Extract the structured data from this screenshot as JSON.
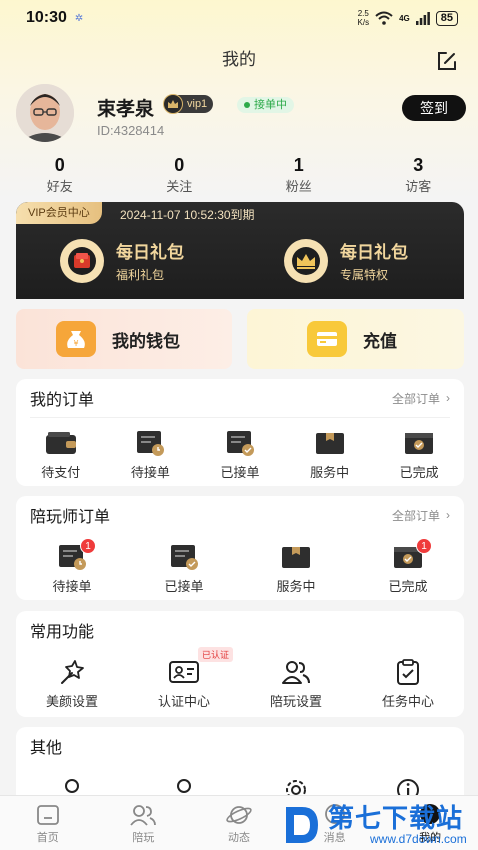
{
  "status_bar": {
    "time": "10:30",
    "net_speed_top": "2.5",
    "net_speed_bottom": "K/s",
    "signal": "4G",
    "battery": "85"
  },
  "header": {
    "title": "我的"
  },
  "profile": {
    "name": "束孝泉",
    "vip_level": "vip1",
    "status": "接单中",
    "user_id": "ID:4328414",
    "checkin_label": "签到"
  },
  "stats": [
    {
      "value": "0",
      "label": "好友"
    },
    {
      "value": "0",
      "label": "关注"
    },
    {
      "value": "1",
      "label": "粉丝"
    },
    {
      "value": "3",
      "label": "访客"
    }
  ],
  "vip_center": {
    "tag": "VIP会员中心",
    "expire": "2024-11-07 10:52:30到期",
    "items": [
      {
        "title": "每日礼包",
        "subtitle": "福利礼包"
      },
      {
        "title": "每日礼包",
        "subtitle": "专属特权"
      }
    ]
  },
  "wallet": {
    "label": "我的钱包"
  },
  "recharge": {
    "label": "充值"
  },
  "my_orders": {
    "title": "我的订单",
    "more": "全部订单",
    "items": [
      {
        "label": "待支付",
        "icon": "wallet-icon"
      },
      {
        "label": "待接单",
        "icon": "clock-box-icon"
      },
      {
        "label": "已接单",
        "icon": "check-box-icon"
      },
      {
        "label": "服务中",
        "icon": "service-box-icon"
      },
      {
        "label": "已完成",
        "icon": "done-box-icon"
      }
    ]
  },
  "companion_orders": {
    "title": "陪玩师订单",
    "more": "全部订单",
    "items": [
      {
        "label": "待接单",
        "badge": "1"
      },
      {
        "label": "已接单",
        "badge": ""
      },
      {
        "label": "服务中",
        "badge": ""
      },
      {
        "label": "已完成",
        "badge": "1"
      }
    ]
  },
  "common_functions": {
    "title": "常用功能",
    "items": [
      {
        "label": "美颜设置",
        "tag": ""
      },
      {
        "label": "认证中心",
        "tag": "已认证"
      },
      {
        "label": "陪玩设置",
        "tag": ""
      },
      {
        "label": "任务中心",
        "tag": ""
      }
    ]
  },
  "others": {
    "title": "其他"
  },
  "bottom_nav": [
    {
      "label": "首页"
    },
    {
      "label": "陪玩"
    },
    {
      "label": "动态"
    },
    {
      "label": "消息"
    },
    {
      "label": "我的"
    }
  ],
  "watermark": {
    "main": "第七下载站",
    "sub": "www.d7down.com"
  },
  "colors": {
    "accent": "#111111",
    "vip_gold": "#f1d69d",
    "badge_red": "#ef3b3b",
    "status_green": "#2daa4a"
  }
}
